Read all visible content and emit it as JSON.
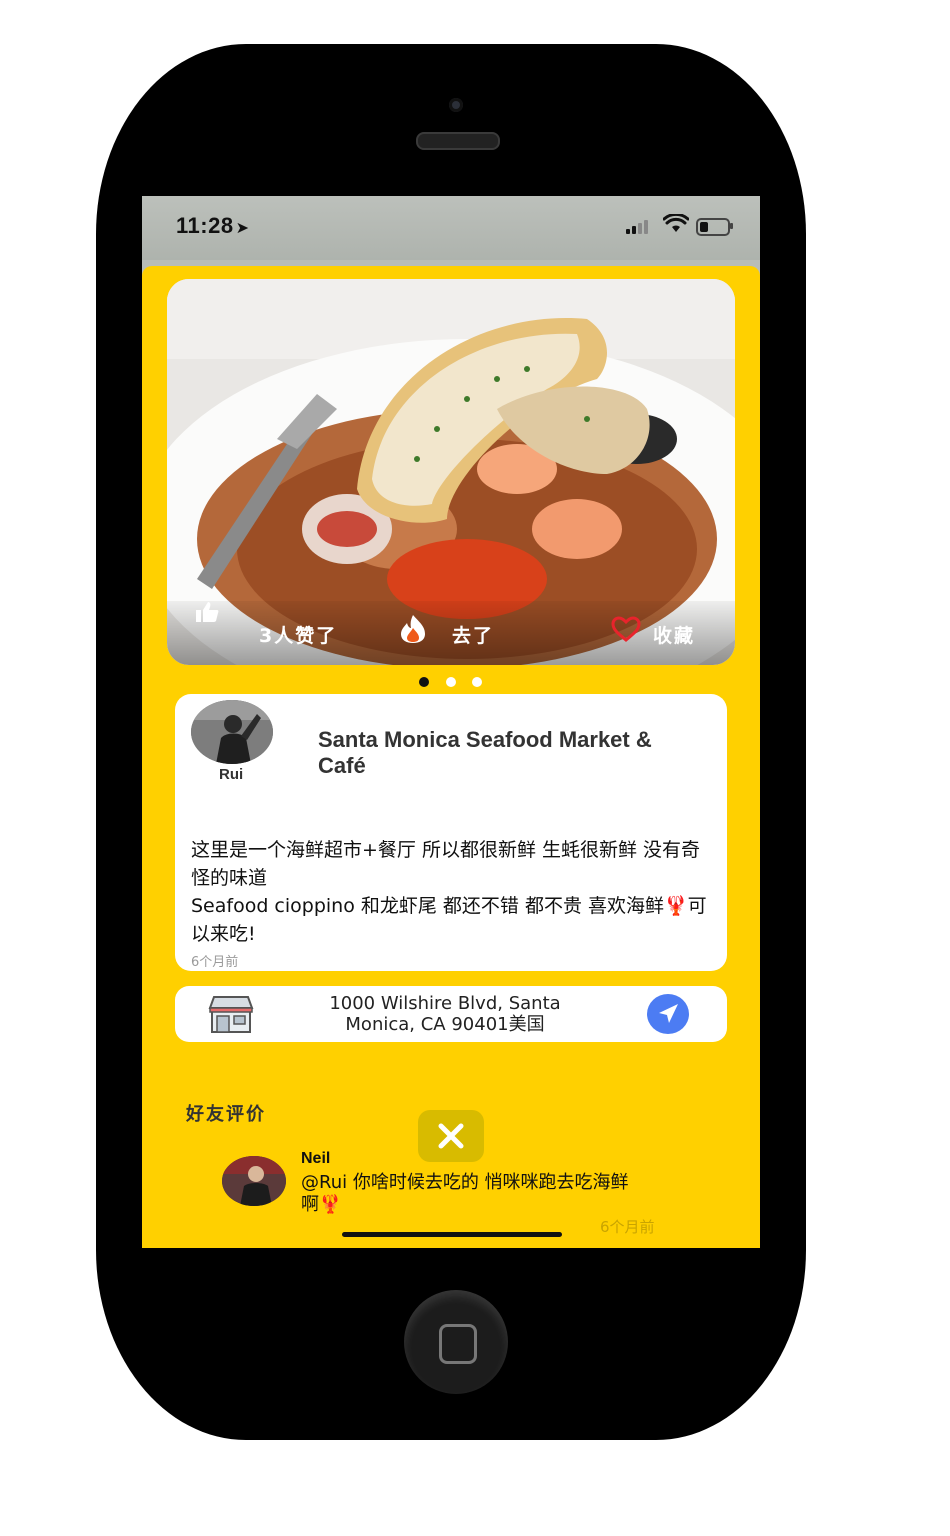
{
  "status_bar": {
    "time": "11:28",
    "location_arrow": "➤"
  },
  "photo": {
    "likes_label": "3人赞了",
    "went_label": "去了",
    "save_label": "收藏",
    "carousel": {
      "count": 3,
      "active_index": 0
    }
  },
  "post": {
    "author": "Rui",
    "place_name": "Santa Monica Seafood Market & Café",
    "body_line1": "这里是一个海鲜超市+餐厅 所以都很新鲜 生蚝很新鲜 没有奇怪的味道",
    "body_line2": "Seafood cioppino 和龙虾尾 都还不错 都不贵 喜欢海鲜🦞可以来吃!",
    "time_ago": "6个月前"
  },
  "address": {
    "text": "1000 Wilshire Blvd, Santa Monica, CA 90401美国"
  },
  "friends": {
    "section_title": "好友评价",
    "comments": [
      {
        "name": "Neil",
        "text": "@Rui 你啥时候去吃的 悄咪咪跑去吃海鲜啊🦞",
        "time_ago": "6个月前"
      }
    ]
  },
  "icons": {
    "like": "thumbs-up-icon",
    "fire": "fire-icon",
    "heart": "heart-icon",
    "store": "store-icon",
    "navigate": "navigate-arrow-icon",
    "close": "close-icon"
  },
  "colors": {
    "sheet": "#ffd000",
    "navigate": "#4c7cf3",
    "heart": "#e8242c"
  }
}
